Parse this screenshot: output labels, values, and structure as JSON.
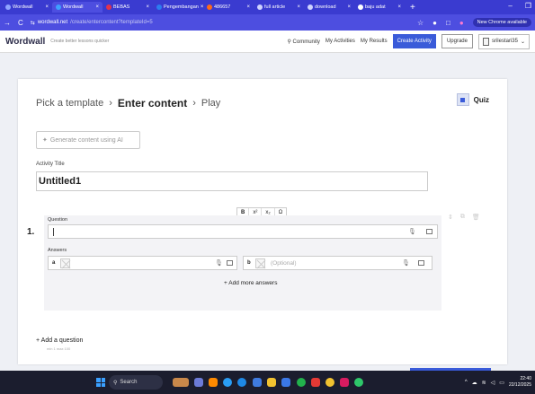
{
  "browser": {
    "tabs": [
      {
        "label": "Wordwall",
        "color": "#8fa4ff",
        "active": false
      },
      {
        "label": "Wordwall",
        "color": "#3ea0ff",
        "active": true
      },
      {
        "label": "BEBAS",
        "color": "#e2334d",
        "active": false
      },
      {
        "label": "Pengembangan",
        "color": "#2c7df0",
        "active": false
      },
      {
        "label": "486657",
        "color": "#ff6a1a",
        "active": false
      },
      {
        "label": "full article",
        "color": "#cfd3ff",
        "active": false
      },
      {
        "label": "download",
        "color": "#cfd3ff",
        "active": false
      },
      {
        "label": "baju adat",
        "color": "#ffffff",
        "active": false
      }
    ],
    "url_host": "wordwall.net",
    "url_path": "/create/entercontent?templateId=5",
    "update_label": "New Chrome available"
  },
  "site": {
    "logo": "Wordwall",
    "tagline": "Create better lessons quicker",
    "nav": {
      "community": "Community",
      "my_activities": "My Activities",
      "my_results": "My Results",
      "create_activity": "Create Activity",
      "upgrade": "Upgrade",
      "username": "srilestari35"
    }
  },
  "editor": {
    "steps": {
      "pick": "Pick a template",
      "enter": "Enter content",
      "play": "Play"
    },
    "template_name": "Quiz",
    "generate_ai": "Generate content using AI",
    "activity_title_label": "Activity Title",
    "activity_title_value": "Untitled1",
    "format_toolbar": [
      "B",
      "x²",
      "x₂",
      "Ω"
    ],
    "question": {
      "number": "1.",
      "label": "Question",
      "value": ""
    },
    "answers_label": "Answers",
    "answers": [
      {
        "letter": "a",
        "placeholder": ""
      },
      {
        "letter": "b",
        "placeholder": "(Optional)"
      }
    ],
    "add_more_answers": "Add more answers",
    "add_question": "Add a question",
    "question_count": "min 1   max 100"
  },
  "taskbar": {
    "search_label": "Search",
    "time": "22:40",
    "date": "22/12/2025"
  }
}
